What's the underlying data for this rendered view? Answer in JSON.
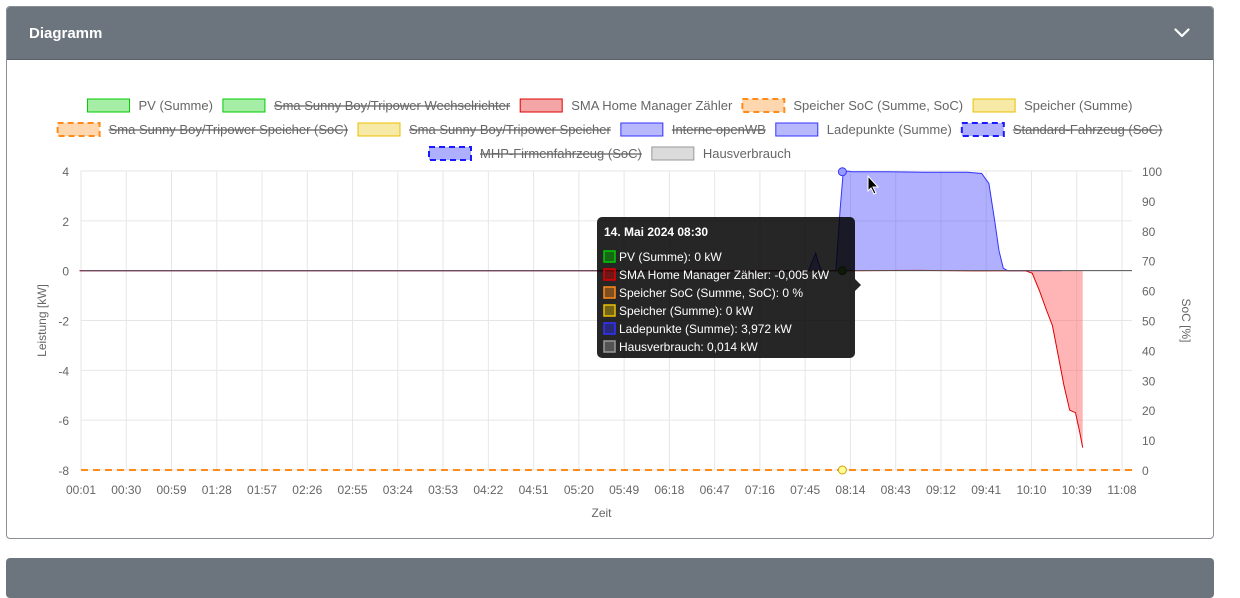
{
  "card": {
    "title": "Diagramm"
  },
  "colors": {
    "header_bg": "#6c757d",
    "pv": "#00cc00",
    "zaehler": "#e00000",
    "soc": "#ff8c1a",
    "speicher": "#e8e800",
    "ladepunkte": "#3333ff",
    "fahrzeug": "#1a1aff",
    "haus": "#999999"
  },
  "legend": [
    {
      "label": "PV (Summe)",
      "color": "#00cc00",
      "dashed": false,
      "hidden": false
    },
    {
      "label": "Sma Sunny Boy/Tripower Wechselrichter",
      "color": "#00cc00",
      "dashed": false,
      "hidden": true
    },
    {
      "label": "SMA Home Manager Zähler",
      "color": "#e00000",
      "dashed": false,
      "hidden": false
    },
    {
      "label": "Speicher SoC (Summe, SoC)",
      "color": "#ff8c1a",
      "dashed": true,
      "hidden": false
    },
    {
      "label": "Speicher (Summe)",
      "color": "#e8c000",
      "dashed": false,
      "hidden": false
    },
    {
      "label": "Sma Sunny Boy/Tripower Speicher (SoC)",
      "color": "#ff8c1a",
      "dashed": true,
      "hidden": true
    },
    {
      "label": "Sma Sunny Boy/Tripower Speicher",
      "color": "#e8c000",
      "dashed": false,
      "hidden": true
    },
    {
      "label": "Interne openWB",
      "color": "#3333ff",
      "dashed": false,
      "hidden": true
    },
    {
      "label": "Ladepunkte (Summe)",
      "color": "#3333ff",
      "dashed": false,
      "hidden": false
    },
    {
      "label": "Standard-Fahrzeug (SoC)",
      "color": "#1a1aff",
      "dashed": true,
      "hidden": true
    },
    {
      "label": "MHP-Firmenfahrzeug (SoC)",
      "color": "#1a1aff",
      "dashed": true,
      "hidden": true
    },
    {
      "label": "Hausverbrauch",
      "color": "#999999",
      "dashed": false,
      "hidden": false
    }
  ],
  "chart_data": {
    "type": "line",
    "xlabel": "Zeit",
    "ylabel": "Leistung [kW]",
    "y2label": "SoC [%]",
    "ylim": [
      -8,
      4
    ],
    "yticks": [
      "4",
      "2",
      "0",
      "-2",
      "-4",
      "-6",
      "-8"
    ],
    "y2lim": [
      0,
      100
    ],
    "y2ticks": [
      "100",
      "90",
      "80",
      "70",
      "60",
      "50",
      "40",
      "30",
      "20",
      "10",
      "0"
    ],
    "x_range_minutes": [
      1,
      681
    ],
    "x_ticks": [
      "00:01",
      "00:30",
      "00:59",
      "01:28",
      "01:57",
      "02:26",
      "02:55",
      "03:24",
      "03:53",
      "04:22",
      "04:51",
      "05:20",
      "05:49",
      "06:18",
      "06:47",
      "07:16",
      "07:45",
      "08:14",
      "08:43",
      "09:12",
      "09:41",
      "10:10",
      "10:39",
      "11:08"
    ],
    "grid": true,
    "series": [
      {
        "name": "Ladepunkte (Summe)",
        "values_kw": [
          [
            0,
            0
          ],
          [
            505,
            0
          ],
          [
            510,
            0.7
          ],
          [
            512,
            0.3
          ],
          [
            514,
            0
          ],
          [
            524,
            0
          ],
          [
            527,
            2.5
          ],
          [
            529,
            3.9
          ],
          [
            532,
            4.0
          ],
          [
            535,
            3.97
          ],
          [
            560,
            3.97
          ],
          [
            585,
            3.95
          ],
          [
            615,
            3.95
          ],
          [
            625,
            3.9
          ],
          [
            630,
            3.5
          ],
          [
            634,
            2.0
          ],
          [
            637,
            0.8
          ],
          [
            640,
            0.1
          ],
          [
            643,
            0
          ],
          [
            680,
            0
          ]
        ]
      },
      {
        "name": "SMA Home Manager Zähler",
        "values_kw": [
          [
            0,
            0
          ],
          [
            530,
            0
          ],
          [
            580,
            0.01
          ],
          [
            620,
            -0.01
          ],
          [
            655,
            0
          ],
          [
            660,
            -0.1
          ],
          [
            665,
            -0.8
          ],
          [
            670,
            -1.6
          ],
          [
            674,
            -2.2
          ],
          [
            678,
            -3.4
          ],
          [
            682,
            -4.6
          ],
          [
            686,
            -5.6
          ],
          [
            690,
            -5.7
          ],
          [
            693,
            -6.5
          ],
          [
            695,
            -7.1
          ]
        ]
      },
      {
        "name": "PV (Summe)",
        "values_kw": [
          [
            0,
            0
          ],
          [
            695,
            0
          ]
        ]
      },
      {
        "name": "Hausverbrauch",
        "values_kw": [
          [
            0,
            0
          ],
          [
            695,
            0
          ]
        ]
      },
      {
        "name": "Speicher SoC (Summe, SoC)",
        "values_pct": [
          [
            0,
            0
          ],
          [
            695,
            0
          ]
        ]
      }
    ],
    "tooltip": {
      "title": "14. Mai 2024 08:30",
      "items": [
        {
          "text": "PV (Summe): 0 kW",
          "color": "#00cc00"
        },
        {
          "text": "SMA Home Manager Zähler: -0,005 kW",
          "color": "#e00000"
        },
        {
          "text": "Speicher SoC (Summe, SoC): 0 %",
          "color": "#ff8c1a"
        },
        {
          "text": "Speicher (Summe): 0 kW",
          "color": "#e8c000"
        },
        {
          "text": "Ladepunkte (Summe): 3,972 kW",
          "color": "#3333ff"
        },
        {
          "text": "Hausverbrauch: 0,014 kW",
          "color": "#999999"
        }
      ]
    }
  }
}
